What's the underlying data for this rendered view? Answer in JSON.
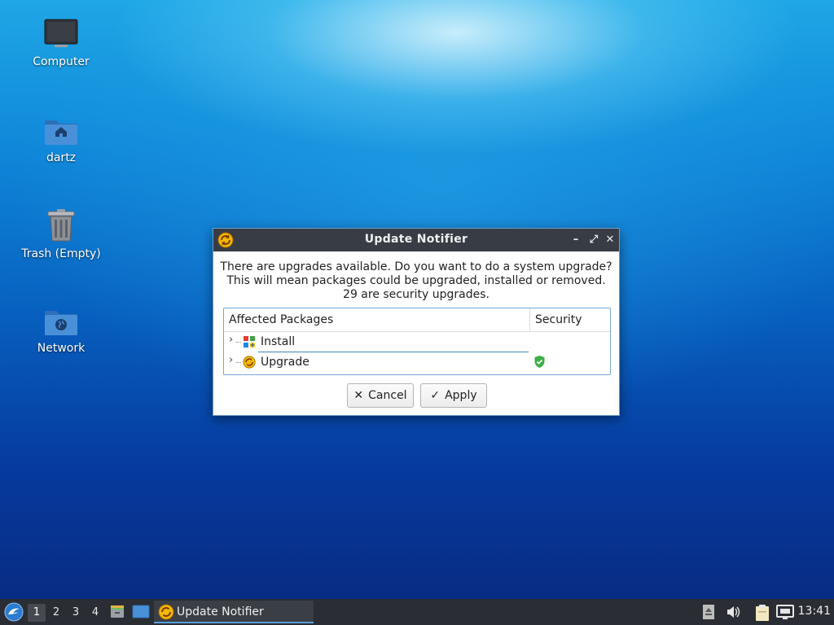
{
  "desktop": {
    "icons": [
      {
        "label": "Computer"
      },
      {
        "label": "dartz"
      },
      {
        "label": "Trash (Empty)"
      },
      {
        "label": "Network"
      }
    ]
  },
  "dialog": {
    "title": "Update Notifier",
    "message_lines": [
      "There are upgrades available. Do you want to do a system upgrade?",
      "This will mean packages could be upgraded, installed or removed.",
      "29 are security upgrades."
    ],
    "columns": {
      "affected": "Affected Packages",
      "security": "Security"
    },
    "rows": [
      {
        "label": "Install",
        "icon": "install-icon",
        "security": false
      },
      {
        "label": "Upgrade",
        "icon": "upgrade-icon",
        "security": true
      }
    ],
    "buttons": {
      "cancel": "Cancel",
      "apply": "Apply"
    },
    "window_controls": {
      "minimize": "–",
      "maximize": "⤢",
      "close": "✕"
    }
  },
  "taskbar": {
    "workspaces": [
      "1",
      "2",
      "3",
      "4"
    ],
    "active_workspace": "1",
    "task_label": "Update Notifier",
    "clock": "13:41"
  },
  "colors": {
    "accent": "#5a9fdc",
    "titlebar": "#383c44",
    "taskbar": "#2a2d33",
    "security_shield": "#3fae49"
  }
}
